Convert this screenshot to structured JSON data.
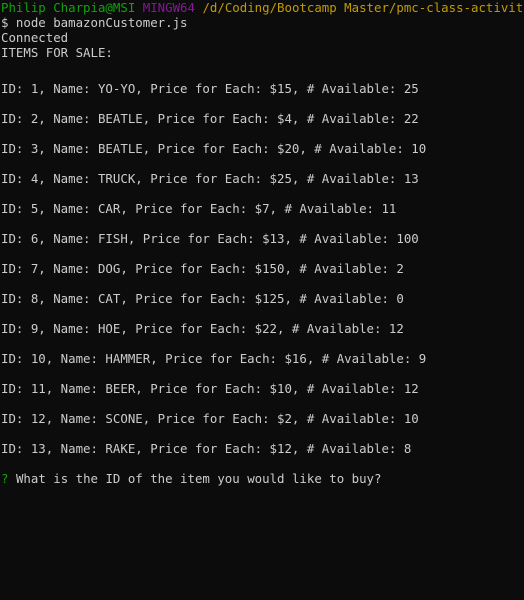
{
  "prompt_header": {
    "user": "Philip Charpia@MSI",
    "env": "MINGW64",
    "path": "/d/Coding/Bootcamp Master/pmc-class-activities"
  },
  "command": "$ node bamazonCustomer.js",
  "status": "Connected",
  "heading": "ITEMS FOR SALE:",
  "items": [
    "ID: 1, Name: YO-YO, Price for Each: $15, # Available: 25",
    "ID: 2, Name: BEATLE, Price for Each: $4, # Available: 22",
    "ID: 3, Name: BEATLE, Price for Each: $20, # Available: 10",
    "ID: 4, Name: TRUCK, Price for Each: $25, # Available: 13",
    "ID: 5, Name: CAR, Price for Each: $7, # Available: 11",
    "ID: 6, Name: FISH, Price for Each: $13, # Available: 100",
    "ID: 7, Name: DOG, Price for Each: $150, # Available: 2",
    "ID: 8, Name: CAT, Price for Each: $125, # Available: 0",
    "ID: 9, Name: HOE, Price for Each: $22, # Available: 12",
    "ID: 10, Name: HAMMER, Price for Each: $16, # Available: 9",
    "ID: 11, Name: BEER, Price for Each: $10, # Available: 12",
    "ID: 12, Name: SCONE, Price for Each: $2, # Available: 10",
    "ID: 13, Name: RAKE, Price for Each: $12, # Available: 8"
  ],
  "question": {
    "marker": "?",
    "text": "What is the ID of the item you would like to buy?"
  },
  "colors": {
    "background": "#0c0c0c",
    "text": "#cccccc",
    "user": "#13a10e",
    "env": "#881798",
    "path": "#c19c00"
  }
}
